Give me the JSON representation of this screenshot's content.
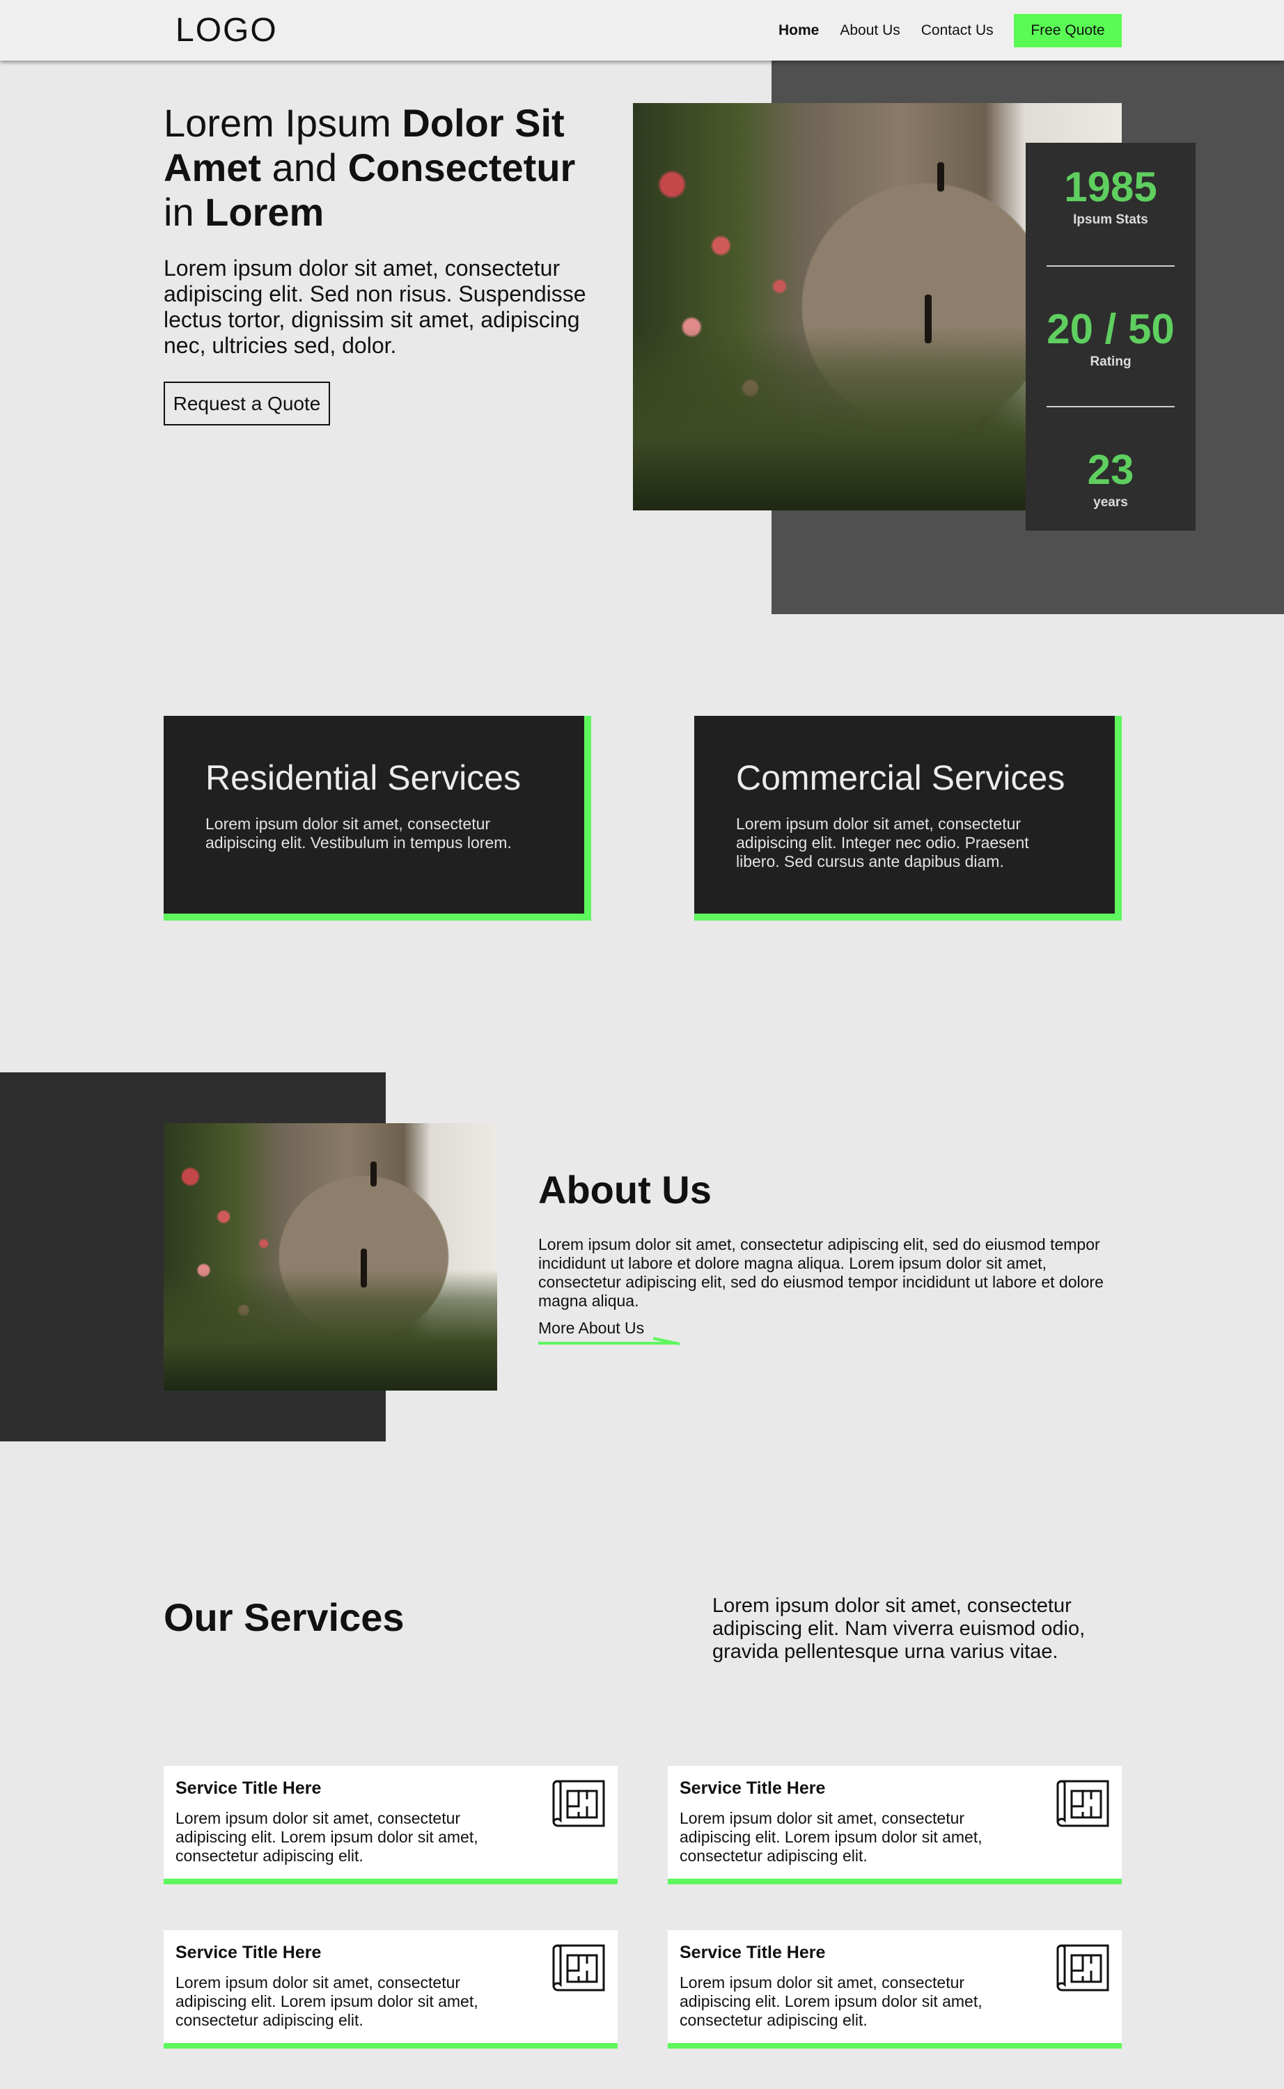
{
  "nav": {
    "logo": "LOGO",
    "links": [
      "Home",
      "About Us",
      "Contact Us"
    ],
    "cta": "Free Quote"
  },
  "hero": {
    "title_parts": [
      "Lorem Ipsum ",
      "Dolor Sit Amet",
      " and ",
      "Consectetur",
      " in ",
      "Lorem"
    ],
    "text": "Lorem ipsum dolor sit amet, consectetur adipiscing elit. Sed non risus. Suspendisse lectus tortor, dignissim sit amet, adipiscing nec, ultricies sed, dolor.",
    "button": "Request a Quote",
    "stats": [
      {
        "value": "1985",
        "label": "Ipsum Stats"
      },
      {
        "value": "20 / 50",
        "label": "Rating"
      },
      {
        "value": "23",
        "label": "years"
      }
    ]
  },
  "services_cards": [
    {
      "title": "Residential Services",
      "text": "Lorem ipsum dolor sit amet, consectetur adipiscing elit. Vestibulum in tempus lorem."
    },
    {
      "title": "Commercial Services",
      "text": "Lorem ipsum dolor sit amet, consectetur adipiscing elit. Integer nec odio. Praesent libero. Sed cursus ante dapibus diam."
    }
  ],
  "about": {
    "title": "About Us",
    "text": "Lorem ipsum dolor sit amet, consectetur adipiscing elit, sed do eiusmod tempor incididunt ut labore et dolore magna aliqua. Lorem ipsum dolor sit amet, consectetur adipiscing elit, sed do eiusmod tempor incididunt ut labore et dolore magna aliqua.",
    "link": "More About Us"
  },
  "our_services": {
    "title": "Our Services",
    "text": "Lorem ipsum dolor sit amet, consectetur adipiscing elit. Nam viverra euismod odio, gravida pellentesque urna varius vitae.",
    "items": [
      {
        "title": "Service Title Here",
        "text": "Lorem ipsum dolor sit amet, consectetur adipiscing elit. Lorem ipsum dolor sit amet, consectetur adipiscing elit.",
        "icon": "blueprint-icon"
      },
      {
        "title": "Service Title Here",
        "text": "Lorem ipsum dolor sit amet, consectetur adipiscing elit. Lorem ipsum dolor sit amet, consectetur adipiscing elit.",
        "icon": "blueprint-icon"
      },
      {
        "title": "Service Title Here",
        "text": "Lorem ipsum dolor sit amet, consectetur adipiscing elit. Lorem ipsum dolor sit amet, consectetur adipiscing elit.",
        "icon": "blueprint-icon"
      },
      {
        "title": "Service Title Here",
        "text": "Lorem ipsum dolor sit amet, consectetur adipiscing elit. Lorem ipsum dolor sit amet, consectetur adipiscing elit.",
        "icon": "blueprint-icon"
      }
    ]
  },
  "colors": {
    "accent": "#5ef75e",
    "stat_green": "#5fcf5f",
    "dark": "#202020",
    "background": "#e9e9e9"
  }
}
